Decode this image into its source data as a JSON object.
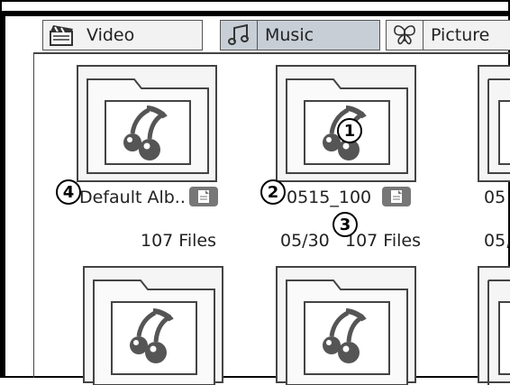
{
  "tabs": [
    {
      "label": "Video",
      "icon": "clapperboard-icon",
      "active": false
    },
    {
      "label": "Music",
      "icon": "music-note-icon",
      "active": true
    },
    {
      "label": "Picture",
      "icon": "butterfly-icon",
      "active": false
    }
  ],
  "albums": [
    {
      "name": "Default Alb..",
      "count": "107 Files",
      "date": ""
    },
    {
      "name": "0515_100",
      "count": "107 Files",
      "date": "05/30"
    },
    {
      "name": "05",
      "count": "",
      "date": "05,"
    }
  ],
  "callouts": [
    "1",
    "2",
    "3",
    "4"
  ],
  "colors": {
    "active_tab": "#c7ced6",
    "frame": "#000000",
    "icon_gray": "#666666"
  }
}
